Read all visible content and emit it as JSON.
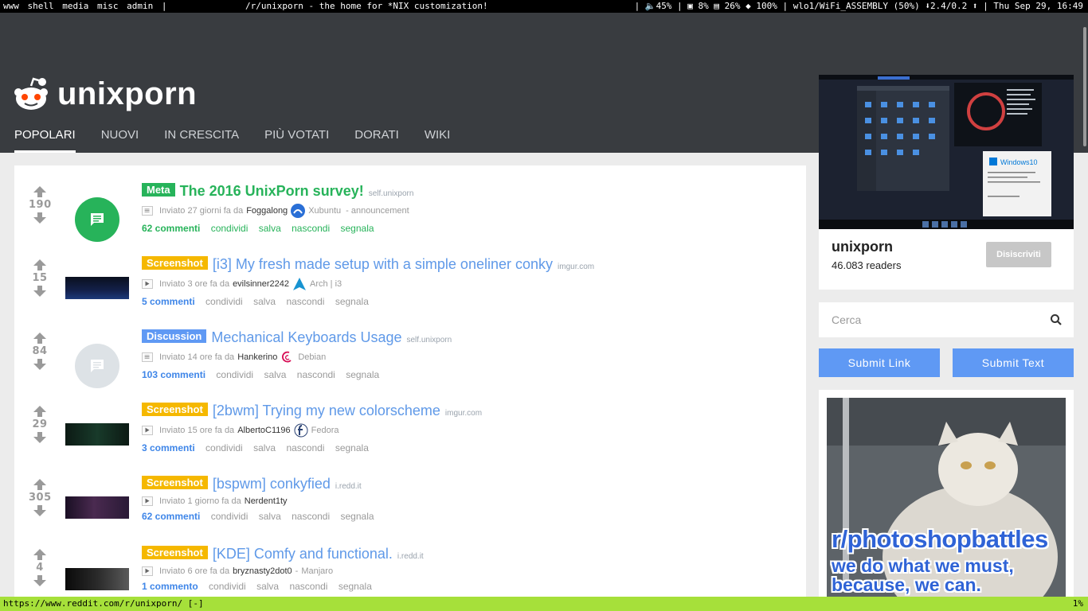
{
  "topbar": {
    "tags": [
      "www",
      "shell",
      "media",
      "misc",
      "admin",
      "|"
    ],
    "window_title": "/r/unixporn - the home for *NIX customization!",
    "stats": "| 🔈45%  | ▣ 8%  ▤ 26%  ◆ 100% | wlo1/WiFi_ASSEMBLY (50%) ⬇2.4/0.2 ⬆ | Thu Sep 29, 16:49"
  },
  "brand": {
    "name": "unixporn"
  },
  "nav": [
    "POPOLARI",
    "NUOVI",
    "IN CRESCITA",
    "PIÙ VOTATI",
    "DORATI",
    "WIKI"
  ],
  "posts": [
    {
      "score": "190",
      "flair": "Meta",
      "flair_color": "#27b35a",
      "title": "The 2016 UnixPorn survey!",
      "title_color": "#27b35a",
      "domain": "self.unixporn",
      "meta_prefix": "Inviato 27 giorni fa da",
      "user": "Foggalong",
      "user_flair": "Xubuntu",
      "extra": "- announcement",
      "comments": "62 commenti",
      "comments_color": "#27b35a",
      "links": [
        "condividi",
        "salva",
        "nascondi",
        "segnala"
      ],
      "links_color": "#27b35a"
    },
    {
      "score": "15",
      "flair": "Screenshot",
      "flair_color": "#f5b800",
      "title": "[i3] My fresh made setup with a simple oneliner conky",
      "title_color": "#5f99e8",
      "domain": "imgur.com",
      "meta_prefix": "Inviato 3 ore fa da",
      "user": "evilsinner2242",
      "user_flair": "Arch | i3",
      "extra": "",
      "comments": "5 commenti",
      "comments_color": "#3f86e8",
      "links": [
        "condividi",
        "salva",
        "nascondi",
        "segnala"
      ],
      "links_color": "#9a9a9a"
    },
    {
      "score": "84",
      "flair": "Discussion",
      "flair_color": "#5f99f4",
      "title": "Mechanical Keyboards Usage",
      "title_color": "#5f99e8",
      "domain": "self.unixporn",
      "meta_prefix": "Inviato 14 ore fa da",
      "user": "Hankerino",
      "user_flair": "Debian",
      "extra": "",
      "comments": "103 commenti",
      "comments_color": "#3f86e8",
      "links": [
        "condividi",
        "salva",
        "nascondi",
        "segnala"
      ],
      "links_color": "#9a9a9a"
    },
    {
      "score": "29",
      "flair": "Screenshot",
      "flair_color": "#f5b800",
      "title": "[2bwm] Trying my new colorscheme",
      "title_color": "#5f99e8",
      "domain": "imgur.com",
      "meta_prefix": "Inviato 15 ore fa da",
      "user": "AlbertoC1196",
      "user_flair": "Fedora",
      "extra": "",
      "comments": "3 commenti",
      "comments_color": "#3f86e8",
      "links": [
        "condividi",
        "salva",
        "nascondi",
        "segnala"
      ],
      "links_color": "#9a9a9a"
    },
    {
      "score": "305",
      "flair": "Screenshot",
      "flair_color": "#f5b800",
      "title": "[bspwm] conkyfied",
      "title_color": "#5f99e8",
      "domain": "i.redd.it",
      "meta_prefix": "Inviato 1 giorno fa da",
      "user": "Nerdent1ty",
      "user_flair": "",
      "extra": "",
      "comments": "62 commenti",
      "comments_color": "#3f86e8",
      "links": [
        "condividi",
        "salva",
        "nascondi",
        "segnala"
      ],
      "links_color": "#9a9a9a"
    },
    {
      "score": "4",
      "flair": "Screenshot",
      "flair_color": "#f5b800",
      "title": "[KDE] Comfy and functional.",
      "title_color": "#5f99e8",
      "domain": "i.redd.it",
      "meta_prefix": "Inviato 6 ore fa da",
      "user": "bryznasty2dot0",
      "user_flair": "Manjaro",
      "extra": "",
      "comments": "1 commento",
      "comments_color": "#3f86e8",
      "links": [
        "condividi",
        "salva",
        "nascondi",
        "segnala"
      ],
      "links_color": "#9a9a9a"
    }
  ],
  "sidebar": {
    "banner_window_label": "Windows10",
    "sub_name": "unixporn",
    "readers": "46.083 readers",
    "unsubscribe": "Disiscriviti",
    "search_placeholder": "Cerca",
    "submit_link": "Submit Link",
    "submit_text": "Submit Text",
    "ad_line1": "r/photoshopbattles",
    "ad_line2": "we do what we must,",
    "ad_line3": "because, we can."
  },
  "urlbar": {
    "url": "https://www.reddit.com/r/unixporn/ [-]",
    "percent": "1%"
  }
}
